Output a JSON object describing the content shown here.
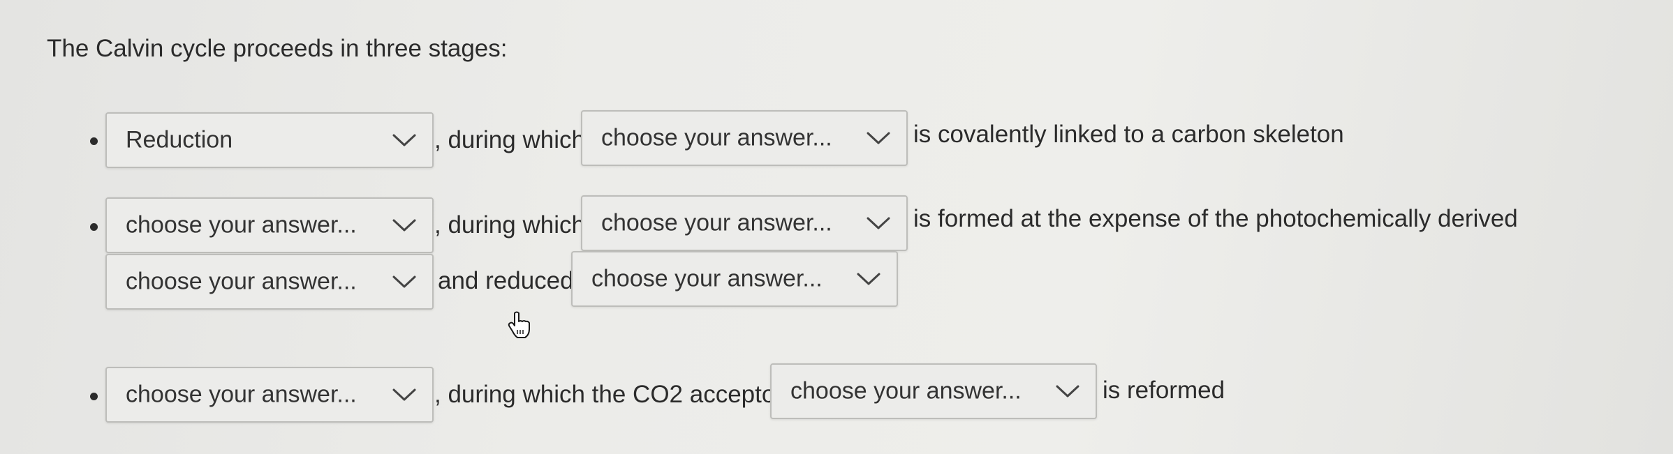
{
  "question": {
    "text": "The Calvin cycle proceeds in three stages:"
  },
  "stages": [
    {
      "stage_select": "Reduction",
      "connector": ", during which",
      "item_select": "choose your answer...",
      "tail": "is covalently linked to a carbon skeleton"
    },
    {
      "stage_select": "choose your answer...",
      "connector": ", during which",
      "item_select": "choose your answer...",
      "tail": "is formed at the expense of the photochemically derived",
      "cont_select": "choose your answer...",
      "cont_connector": "and reduced",
      "cont_select_2": "choose your answer..."
    },
    {
      "stage_select": "choose your answer...",
      "connector": ", during which the CO2 acceptor",
      "item_select": "choose your answer...",
      "tail": "is reformed"
    }
  ],
  "icons": {
    "dropdown": "chevron-down-icon",
    "cursor": "hand-pointer-icon",
    "bullet": "bullet-dot"
  },
  "colors": {
    "background": "#ececea",
    "text": "#2b2b2b",
    "select_border": "#bdbdba"
  }
}
